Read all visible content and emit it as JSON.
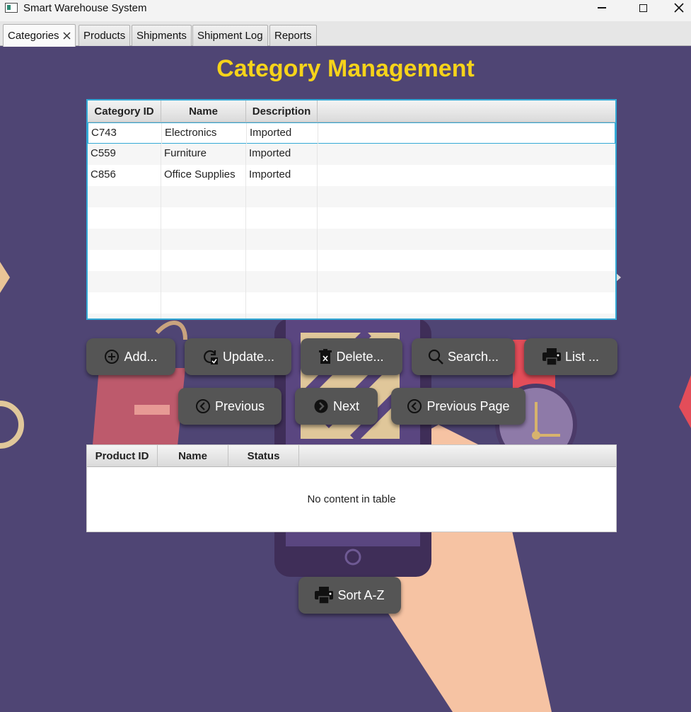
{
  "window": {
    "title": "Smart Warehouse System",
    "minimize_label": "minimize",
    "maximize_label": "maximize",
    "close_label": "close"
  },
  "tabs": [
    {
      "label": "Categories",
      "active": true,
      "closable": true
    },
    {
      "label": "Products"
    },
    {
      "label": "Shipments"
    },
    {
      "label": "Shipment Log"
    },
    {
      "label": "Reports"
    }
  ],
  "page": {
    "title": "Category Management"
  },
  "category_table": {
    "columns": [
      "Category ID",
      "Name",
      "Description"
    ],
    "rows": [
      [
        "C743",
        "Electronics",
        "Imported"
      ],
      [
        "C559",
        "Furniture",
        "Imported"
      ],
      [
        "C856",
        "Office Supplies",
        "Imported"
      ]
    ],
    "selected_row": 0
  },
  "actions": {
    "add": "Add...",
    "update": "Update...",
    "delete": "Delete...",
    "search": "Search...",
    "list": "List ..."
  },
  "navigation": {
    "previous": "Previous",
    "next": "Next",
    "previous_page": "Previous Page"
  },
  "product_table": {
    "columns": [
      "Product ID",
      "Name",
      "Status"
    ],
    "empty_text": "No content in table"
  },
  "sort_button": "Sort A-Z",
  "colors": {
    "background": "#4f4574",
    "title": "#f6d31a",
    "button": "#555555",
    "selection_border": "#33a9d6"
  }
}
